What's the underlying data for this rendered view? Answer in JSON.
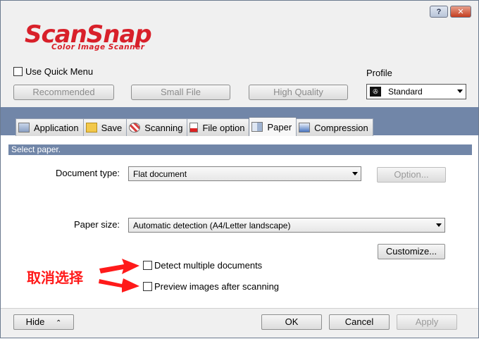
{
  "logo": {
    "main": "ScanSnap",
    "sub": "Color Image Scanner"
  },
  "title_buttons": {
    "help": "?",
    "close": "✕"
  },
  "quick_menu_label": "Use Quick Menu",
  "profile": {
    "label": "Profile",
    "selected": "Standard"
  },
  "presets": [
    "Recommended",
    "Small File",
    "High Quality"
  ],
  "tabs": [
    "Application",
    "Save",
    "Scanning",
    "File option",
    "Paper",
    "Compression"
  ],
  "active_tab": "Paper",
  "header_bar": "Select paper.",
  "document_type": {
    "label": "Document type:",
    "value": "Flat document"
  },
  "option_button": "Option...",
  "paper_size": {
    "label": "Paper size:",
    "value": "Automatic detection (A4/Letter landscape)"
  },
  "customize_button": "Customize...",
  "checks": {
    "detect_multiple": "Detect multiple documents",
    "preview_images": "Preview images after scanning"
  },
  "annotation": "取消选择",
  "footer": {
    "hide": "Hide",
    "ok": "OK",
    "cancel": "Cancel",
    "apply": "Apply"
  },
  "colors": {
    "band": "#7186a8",
    "logo_red": "#d8202a",
    "annotation_red": "#ff1a1a"
  }
}
